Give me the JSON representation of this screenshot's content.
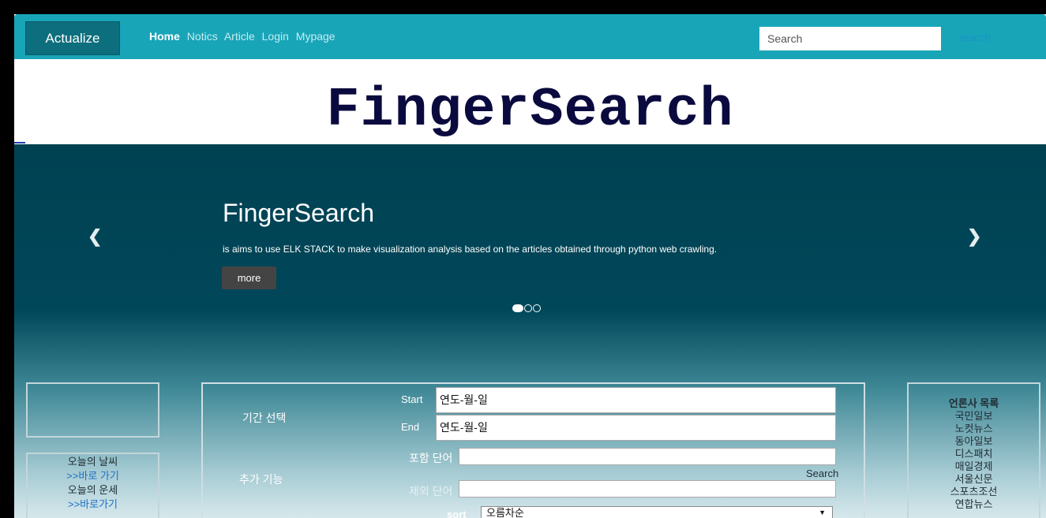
{
  "navbar": {
    "brand": "Actualize",
    "links": [
      "Home",
      "Notics",
      "Article",
      "Login",
      "Mypage"
    ],
    "search_placeholder": "Search",
    "search_button": "search"
  },
  "title": "FingerSearch",
  "carousel": {
    "heading": "FingerSearch",
    "text": "is aims to use ELK STACK to make visualization analysis based on the articles obtained through python web crawling.",
    "more": "more",
    "prev": "❮",
    "next": "❯",
    "active_slide": 1,
    "slide_count": 3
  },
  "left_panel": {
    "weather": "오늘의 날씨",
    "weather_link": ">>바로 가기",
    "fortune": "오늘의 운세",
    "fortune_link": ">>바로가기"
  },
  "search_form": {
    "period_label": "기간 선택",
    "start_label": "Start",
    "start_value": "연도-월-일",
    "end_label": "End",
    "end_value": "연도-월-일",
    "extra_label": "추가 기능",
    "include_label": "포함 단어",
    "search_label": "Search",
    "exclude_label": "제외 단어",
    "sort_label": "sort",
    "sort_value": "오름차순"
  },
  "press_list": {
    "heading": "언론사 목록",
    "items": [
      "국민일보",
      "노컷뉴스",
      "동아일보",
      "디스패치",
      "매일경제",
      "서울신문",
      "스포츠조선",
      "연합뉴스"
    ]
  }
}
